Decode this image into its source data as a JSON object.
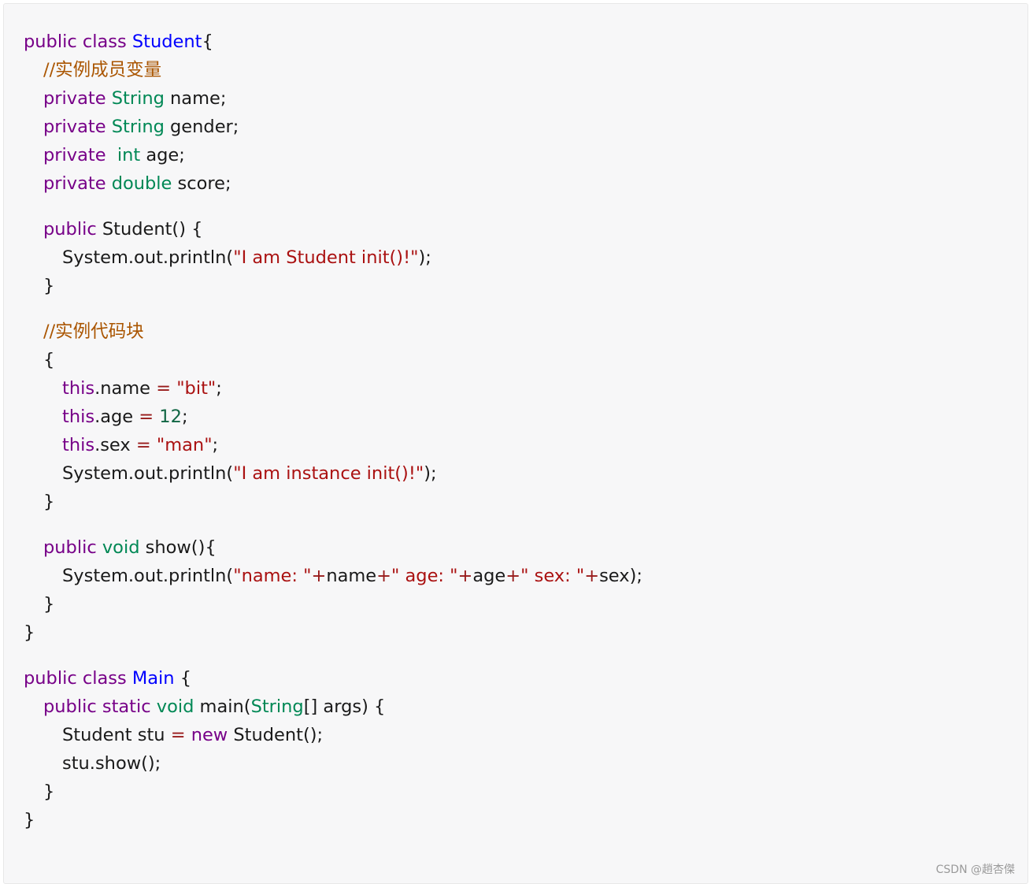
{
  "colors": {
    "keyword": "#770088",
    "type": "#008855",
    "class_name": "#0000ff",
    "string": "#aa1111",
    "number": "#116644",
    "operator": "#981a1a",
    "comment": "#aa5500",
    "plain": "#1a1a1a",
    "background": "#f7f7f8"
  },
  "code": {
    "lines": [
      {
        "indent": 0,
        "tokens": [
          [
            "kw",
            "public class "
          ],
          [
            "def",
            "Student"
          ],
          [
            "plain",
            "{"
          ]
        ]
      },
      {
        "indent": 1,
        "tokens": [
          [
            "comment",
            "//实例成员变量"
          ]
        ]
      },
      {
        "indent": 1,
        "tokens": [
          [
            "kw",
            "private "
          ],
          [
            "type",
            "String"
          ],
          [
            "plain",
            " name;"
          ]
        ]
      },
      {
        "indent": 1,
        "tokens": [
          [
            "kw",
            "private "
          ],
          [
            "type",
            "String"
          ],
          [
            "plain",
            " gender;"
          ]
        ]
      },
      {
        "indent": 1,
        "tokens": [
          [
            "kw",
            "private  "
          ],
          [
            "type",
            "int"
          ],
          [
            "plain",
            " age;"
          ]
        ]
      },
      {
        "indent": 1,
        "tokens": [
          [
            "kw",
            "private "
          ],
          [
            "type",
            "double"
          ],
          [
            "plain",
            " score;"
          ]
        ]
      },
      {
        "gap": true
      },
      {
        "indent": 1,
        "tokens": [
          [
            "kw",
            "public "
          ],
          [
            "plain",
            "Student() {"
          ]
        ]
      },
      {
        "indent": 2,
        "tokens": [
          [
            "plain",
            "System.out.println("
          ],
          [
            "str",
            "\"I am Student init()!\""
          ],
          [
            "plain",
            ");"
          ]
        ]
      },
      {
        "indent": 1,
        "tokens": [
          [
            "plain",
            "}"
          ]
        ]
      },
      {
        "gap": true
      },
      {
        "indent": 1,
        "tokens": [
          [
            "comment",
            "//实例代码块"
          ]
        ]
      },
      {
        "indent": 1,
        "tokens": [
          [
            "plain",
            "{"
          ]
        ]
      },
      {
        "indent": 2,
        "tokens": [
          [
            "kw",
            "this"
          ],
          [
            "plain",
            ".name "
          ],
          [
            "op",
            "="
          ],
          [
            "plain",
            " "
          ],
          [
            "str",
            "\"bit\""
          ],
          [
            "plain",
            ";"
          ]
        ]
      },
      {
        "indent": 2,
        "tokens": [
          [
            "kw",
            "this"
          ],
          [
            "plain",
            ".age "
          ],
          [
            "op",
            "="
          ],
          [
            "plain",
            " "
          ],
          [
            "num",
            "12"
          ],
          [
            "plain",
            ";"
          ]
        ]
      },
      {
        "indent": 2,
        "tokens": [
          [
            "kw",
            "this"
          ],
          [
            "plain",
            ".sex "
          ],
          [
            "op",
            "="
          ],
          [
            "plain",
            " "
          ],
          [
            "str",
            "\"man\""
          ],
          [
            "plain",
            ";"
          ]
        ]
      },
      {
        "indent": 2,
        "tokens": [
          [
            "plain",
            "System.out.println("
          ],
          [
            "str",
            "\"I am instance init()!\""
          ],
          [
            "plain",
            ");"
          ]
        ]
      },
      {
        "indent": 1,
        "tokens": [
          [
            "plain",
            "}"
          ]
        ]
      },
      {
        "gap": true
      },
      {
        "indent": 1,
        "tokens": [
          [
            "kw",
            "public "
          ],
          [
            "type",
            "void"
          ],
          [
            "plain",
            " show(){"
          ]
        ]
      },
      {
        "indent": 2,
        "tokens": [
          [
            "plain",
            "System.out.println("
          ],
          [
            "str",
            "\"name: \""
          ],
          [
            "op",
            "+"
          ],
          [
            "plain",
            "name"
          ],
          [
            "op",
            "+"
          ],
          [
            "str",
            "\" age: \""
          ],
          [
            "op",
            "+"
          ],
          [
            "plain",
            "age"
          ],
          [
            "op",
            "+"
          ],
          [
            "str",
            "\" sex: \""
          ],
          [
            "op",
            "+"
          ],
          [
            "plain",
            "sex);"
          ]
        ]
      },
      {
        "indent": 1,
        "tokens": [
          [
            "plain",
            "}"
          ]
        ]
      },
      {
        "indent": 0,
        "tokens": [
          [
            "plain",
            "}"
          ]
        ]
      },
      {
        "gap": true
      },
      {
        "indent": 0,
        "tokens": [
          [
            "kw",
            "public class "
          ],
          [
            "def",
            "Main"
          ],
          [
            "plain",
            " {"
          ]
        ]
      },
      {
        "indent": 1,
        "tokens": [
          [
            "kw",
            "public static "
          ],
          [
            "type",
            "void"
          ],
          [
            "plain",
            " main("
          ],
          [
            "type",
            "String"
          ],
          [
            "plain",
            "[] args) {"
          ]
        ]
      },
      {
        "indent": 2,
        "tokens": [
          [
            "plain",
            "Student stu "
          ],
          [
            "op",
            "="
          ],
          [
            "plain",
            " "
          ],
          [
            "kw",
            "new"
          ],
          [
            "plain",
            " Student();"
          ]
        ]
      },
      {
        "indent": 2,
        "tokens": [
          [
            "plain",
            "stu.show();"
          ]
        ]
      },
      {
        "indent": 1,
        "tokens": [
          [
            "plain",
            "}"
          ]
        ]
      },
      {
        "indent": 0,
        "tokens": [
          [
            "plain",
            "}"
          ]
        ]
      }
    ]
  },
  "watermark": "CSDN @趙杏傑"
}
